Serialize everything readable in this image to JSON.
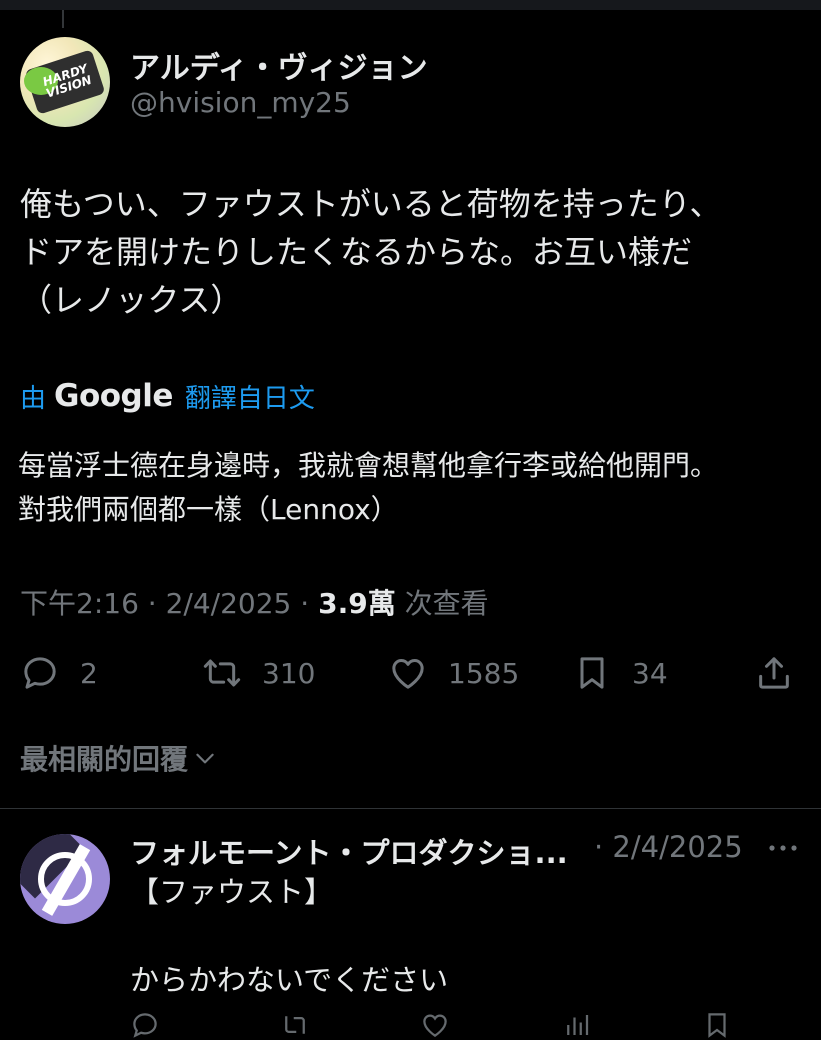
{
  "colors": {
    "background": "#000000",
    "text_primary": "#e7e9ea",
    "text_secondary": "#71767b",
    "link_blue": "#1d9bf0",
    "divider": "#2f3336"
  },
  "tweet": {
    "author_name": "アルディ・ヴィジョン",
    "author_handle": "@hvision_my25",
    "avatar_text": "HARDY VISION",
    "text": "俺もつい、ファウストがいると荷物を持ったり、\nドアを開けたりしたくなるからな。お互い様だ\n（レノックス）",
    "translation": {
      "by_label": "由",
      "provider": "Google",
      "from_label": "翻譯自日文",
      "text": "每當浮士德在身邊時，我就會想幫他拿行李或給他開門。\n對我們兩個都一樣（Lennox）"
    },
    "time": "下午2:16",
    "separator": "·",
    "date": "2/4/2025",
    "views_count": "3.9萬",
    "views_label": "次查看",
    "actions": {
      "reply_icon": "reply-icon",
      "reply_count": "2",
      "retweet_icon": "retweet-icon",
      "retweet_count": "310",
      "like_icon": "heart-icon",
      "like_count": "1585",
      "bookmark_icon": "bookmark-icon",
      "bookmark_count": "34",
      "share_icon": "share-icon"
    }
  },
  "replies_sort": {
    "label": "最相關的回覆",
    "icon": "chevron-down-icon"
  },
  "reply": {
    "author_name": "フォルモーント・プロダクショ...",
    "date": "· 2/4/2025",
    "more_icon": "more-icon",
    "text": "【ファウスト】\n\nからかわないでください"
  }
}
